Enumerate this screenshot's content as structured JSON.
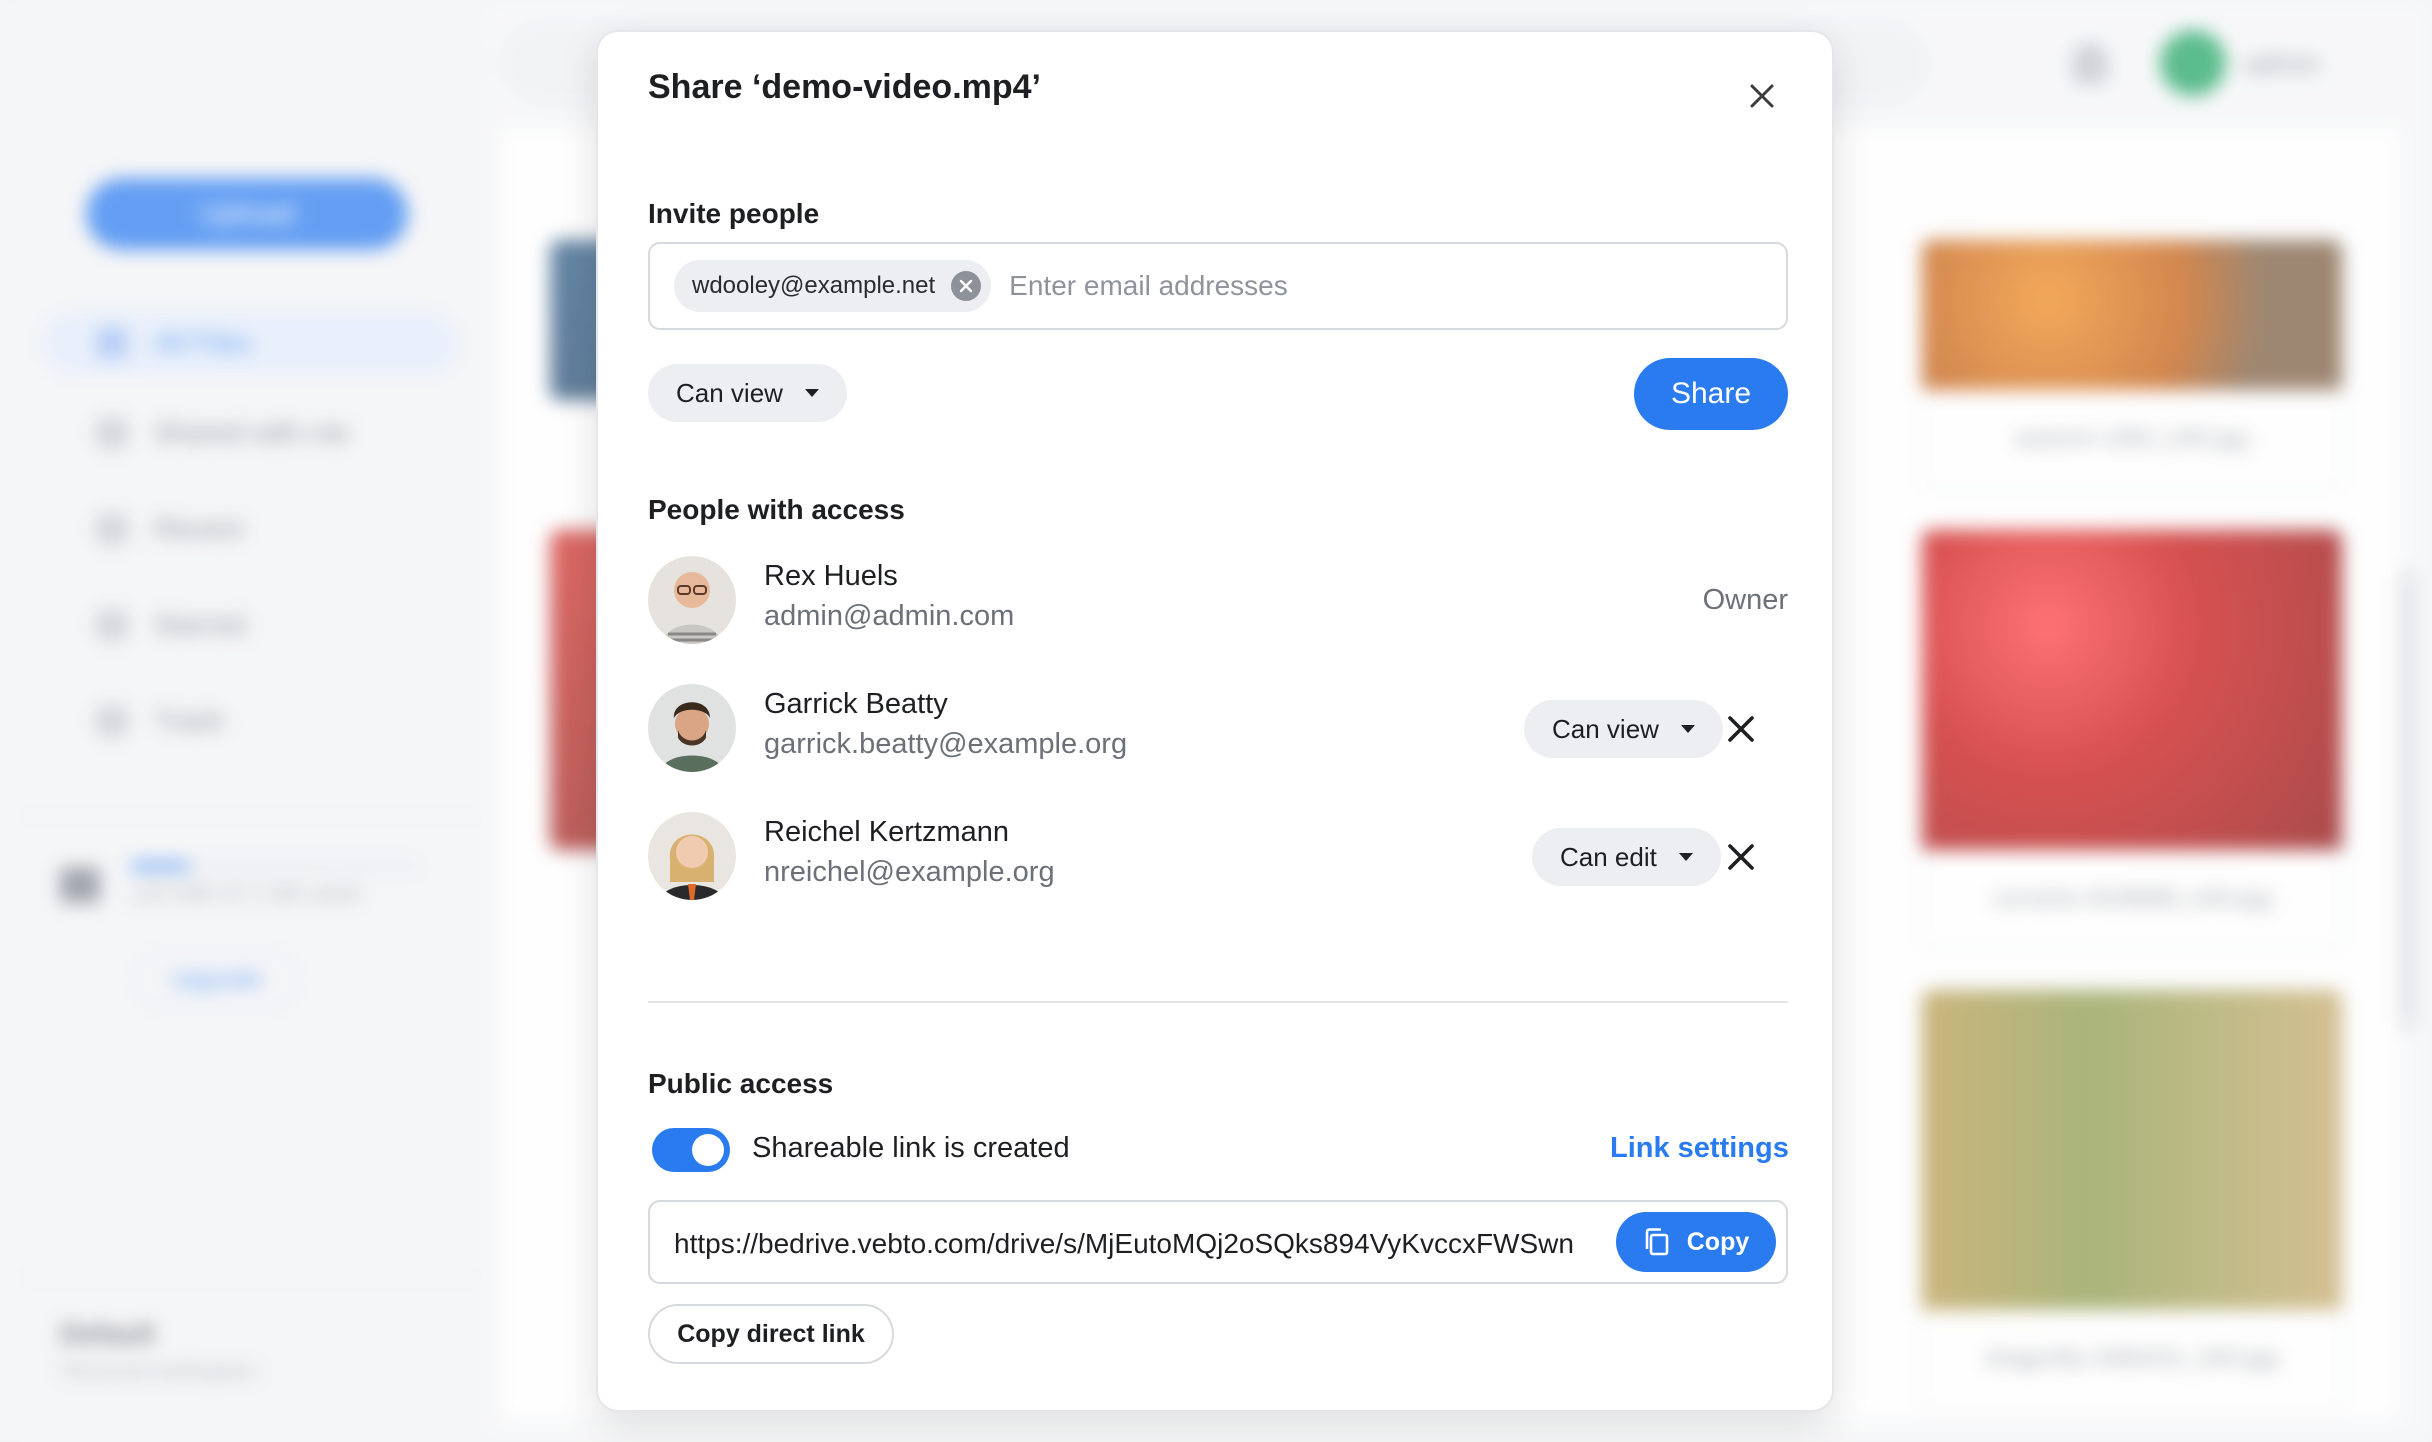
{
  "background": {
    "upload_label": "Upload",
    "nav": [
      "All Files",
      "Shared with me",
      "Recent",
      "Starred",
      "Trash"
    ],
    "storage_text": "120 MB of 1 GB used",
    "upgrade_label": "Upgrade",
    "workspace_name": "Default",
    "workspace_sub": "Personal workspace",
    "user_name": "admin",
    "tiles": [
      "autumn-1902_640.jpg",
      "currants-4038886_640.jpg",
      "dragonfly-3480431_640.jpg"
    ]
  },
  "dialog": {
    "title": "Share ‘demo-video.mp4’",
    "invite": {
      "label": "Invite people",
      "chip": "wdooley@example.net",
      "placeholder": "Enter email addresses",
      "permission": "Can view",
      "share_label": "Share"
    },
    "access": {
      "label": "People with access",
      "people": [
        {
          "name": "Rex Huels",
          "email": "admin@admin.com",
          "role": "Owner"
        },
        {
          "name": "Garrick Beatty",
          "email": "garrick.beatty@example.org",
          "role": "Can view"
        },
        {
          "name": "Reichel Kertzmann",
          "email": "nreichel@example.org",
          "role": "Can edit"
        }
      ]
    },
    "public": {
      "label": "Public access",
      "toggle_label": "Shareable link is created",
      "toggle_on": true,
      "link_settings": "Link settings",
      "url": "https://bedrive.vebto.com/drive/s/MjEutoMQj2oSQks894VyKvccxFWSwn",
      "copy_label": "Copy",
      "direct_label": "Copy direct link"
    }
  },
  "colors": {
    "accent": "#2a7bf0",
    "text": "#1e1f22",
    "muted": "#6c7078"
  }
}
